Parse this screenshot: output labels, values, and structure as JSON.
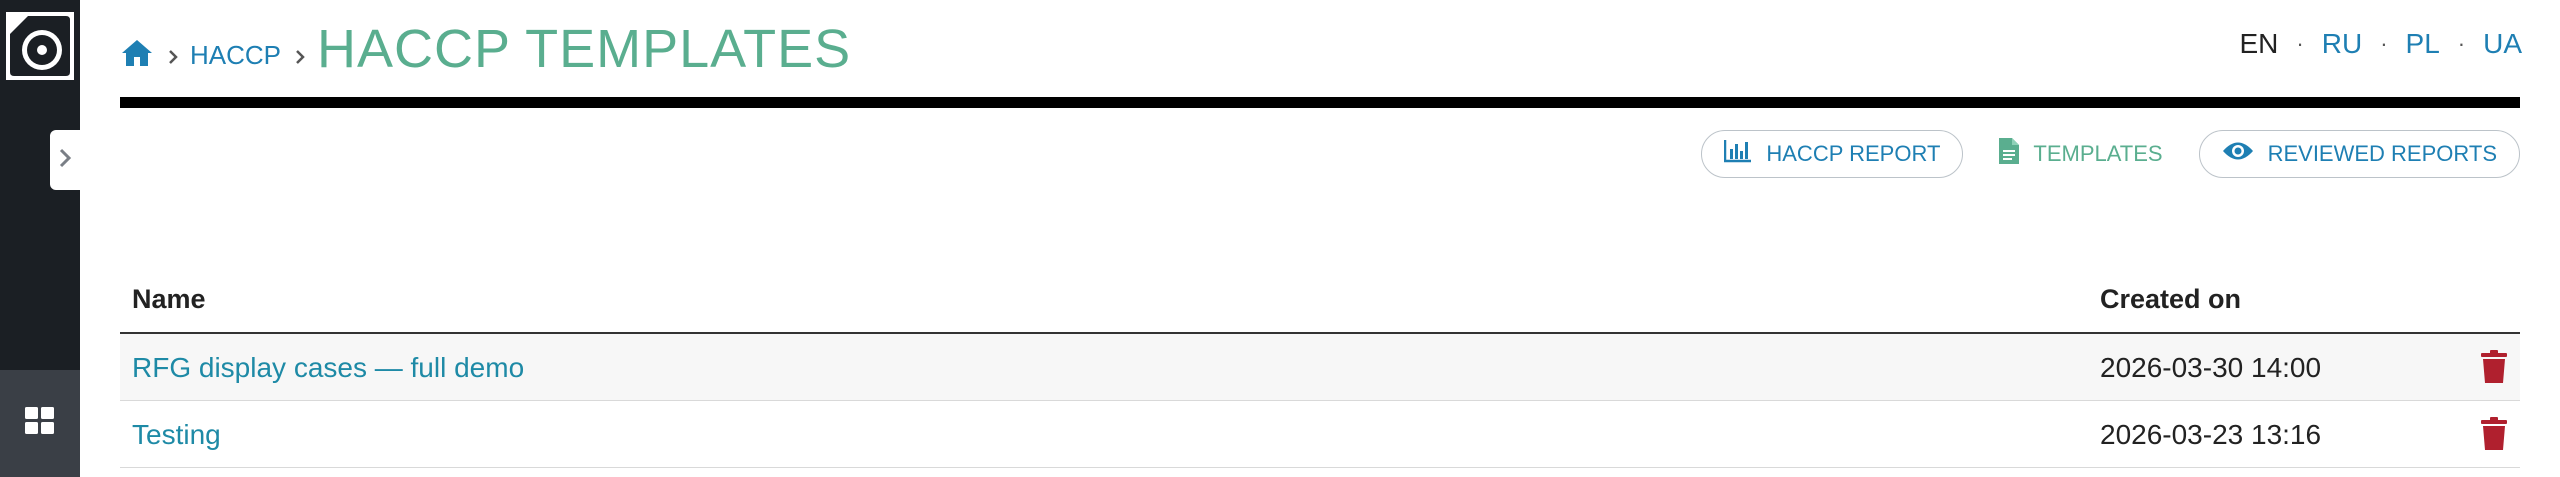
{
  "sidebar": {
    "logo": "app-logo",
    "collapse_icon": "chevron-right-icon",
    "apps_icon": "grid-icon"
  },
  "breadcrumb": {
    "home_icon": "home-icon",
    "crumbs": [
      "HACCP"
    ],
    "current": "HACCP TEMPLATES"
  },
  "languages": {
    "active": "EN",
    "others": [
      "RU",
      "PL",
      "UA"
    ],
    "separator": "·"
  },
  "toolbar": {
    "haccp_report": "HACCP REPORT",
    "templates": "TEMPLATES",
    "reviewed_reports": "REVIEWED REPORTS"
  },
  "table": {
    "columns": [
      "Name",
      "Created on"
    ],
    "rows": [
      {
        "name": "RFG display cases — full demo",
        "created": "2026-03-30 14:00"
      },
      {
        "name": "Testing",
        "created": "2026-03-23 13:16"
      }
    ]
  },
  "colors": {
    "sidebar": "#1b1f24",
    "link": "#1e7fb3",
    "title": "#5aae8f",
    "delete": "#b0202e"
  }
}
